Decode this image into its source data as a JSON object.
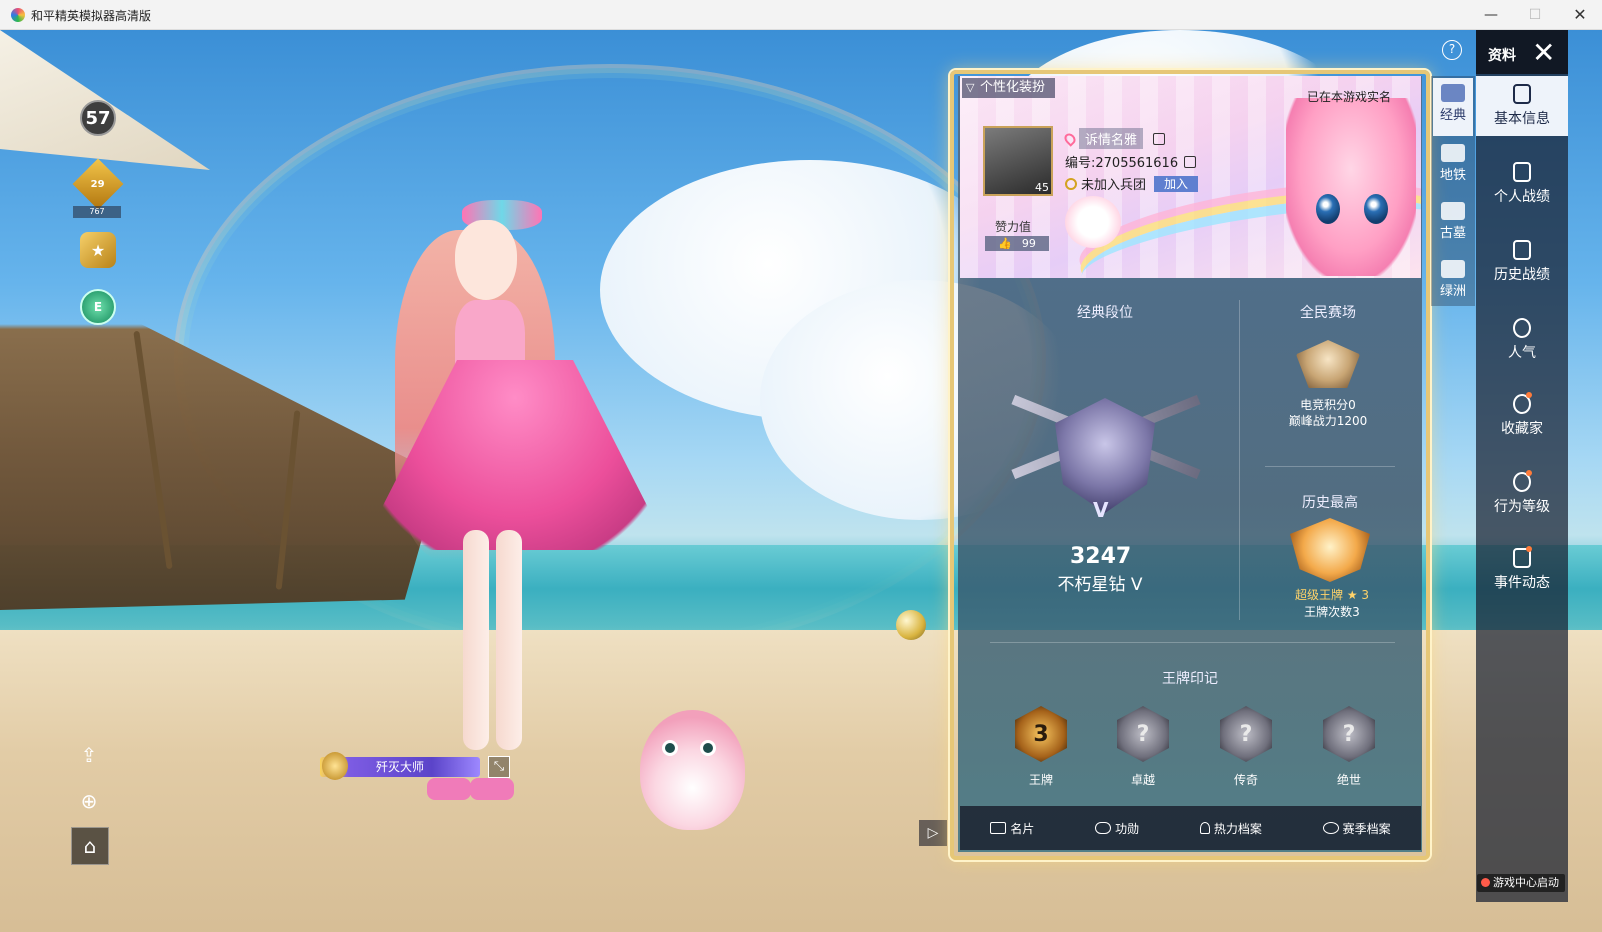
{
  "window": {
    "title": "和平精英模拟器高清版",
    "btn_min": "—",
    "btn_max": "☐",
    "btn_close": "✕"
  },
  "hud": {
    "level": "57",
    "tier_badge": "29",
    "tier_sub": "767",
    "green_badge": "E",
    "title_plate": "歼灭大师",
    "share_glyph": "⇪",
    "zoom_glyph": "⊕",
    "home_glyph": "⌂",
    "edit_glyph": "⤡",
    "expand_glyph": "▷"
  },
  "card": {
    "label": "个性化装扮",
    "verify": "已在本游戏实名",
    "avatar_level": "45",
    "name": "诉情名雅",
    "id": "编号:2705561616",
    "team": "未加入兵团",
    "join": "加入",
    "likes_label": "赞力值",
    "likes_value": "99",
    "likes_glyph": "👍"
  },
  "ranks": {
    "classic_title": "经典段位",
    "classic_points": "3247",
    "classic_name": "不朽星钻 V",
    "classic_numeral": "V",
    "national_title": "全民赛场",
    "esports_points": "电竞积分0",
    "peak_power": "巅峰战力1200",
    "history_title": "历史最高",
    "history_name": "超级王牌",
    "history_stars": "★ 3",
    "ace_count": "王牌次数3",
    "seal_title": "王牌印记",
    "seals": [
      {
        "glyph": "3",
        "label": "王牌"
      },
      {
        "glyph": "?",
        "label": "卓越"
      },
      {
        "glyph": "?",
        "label": "传奇"
      },
      {
        "glyph": "?",
        "label": "绝世"
      }
    ]
  },
  "panel_tabs": [
    "名片",
    "功勋",
    "热力档案",
    "赛季档案"
  ],
  "modes": [
    "经典",
    "地铁",
    "古墓",
    "绿洲"
  ],
  "rail": {
    "header": "资料",
    "close": "✕",
    "help": "?",
    "items": [
      "基本信息",
      "个人战绩",
      "历史战绩",
      "人气",
      "收藏家",
      "行为等级",
      "事件动态"
    ]
  },
  "footer_chip": "游戏中心启动",
  "colors": {
    "frame_gold": "#e6c777",
    "join_blue": "#5f7fd0",
    "ace_gold": "#ffd36a"
  }
}
